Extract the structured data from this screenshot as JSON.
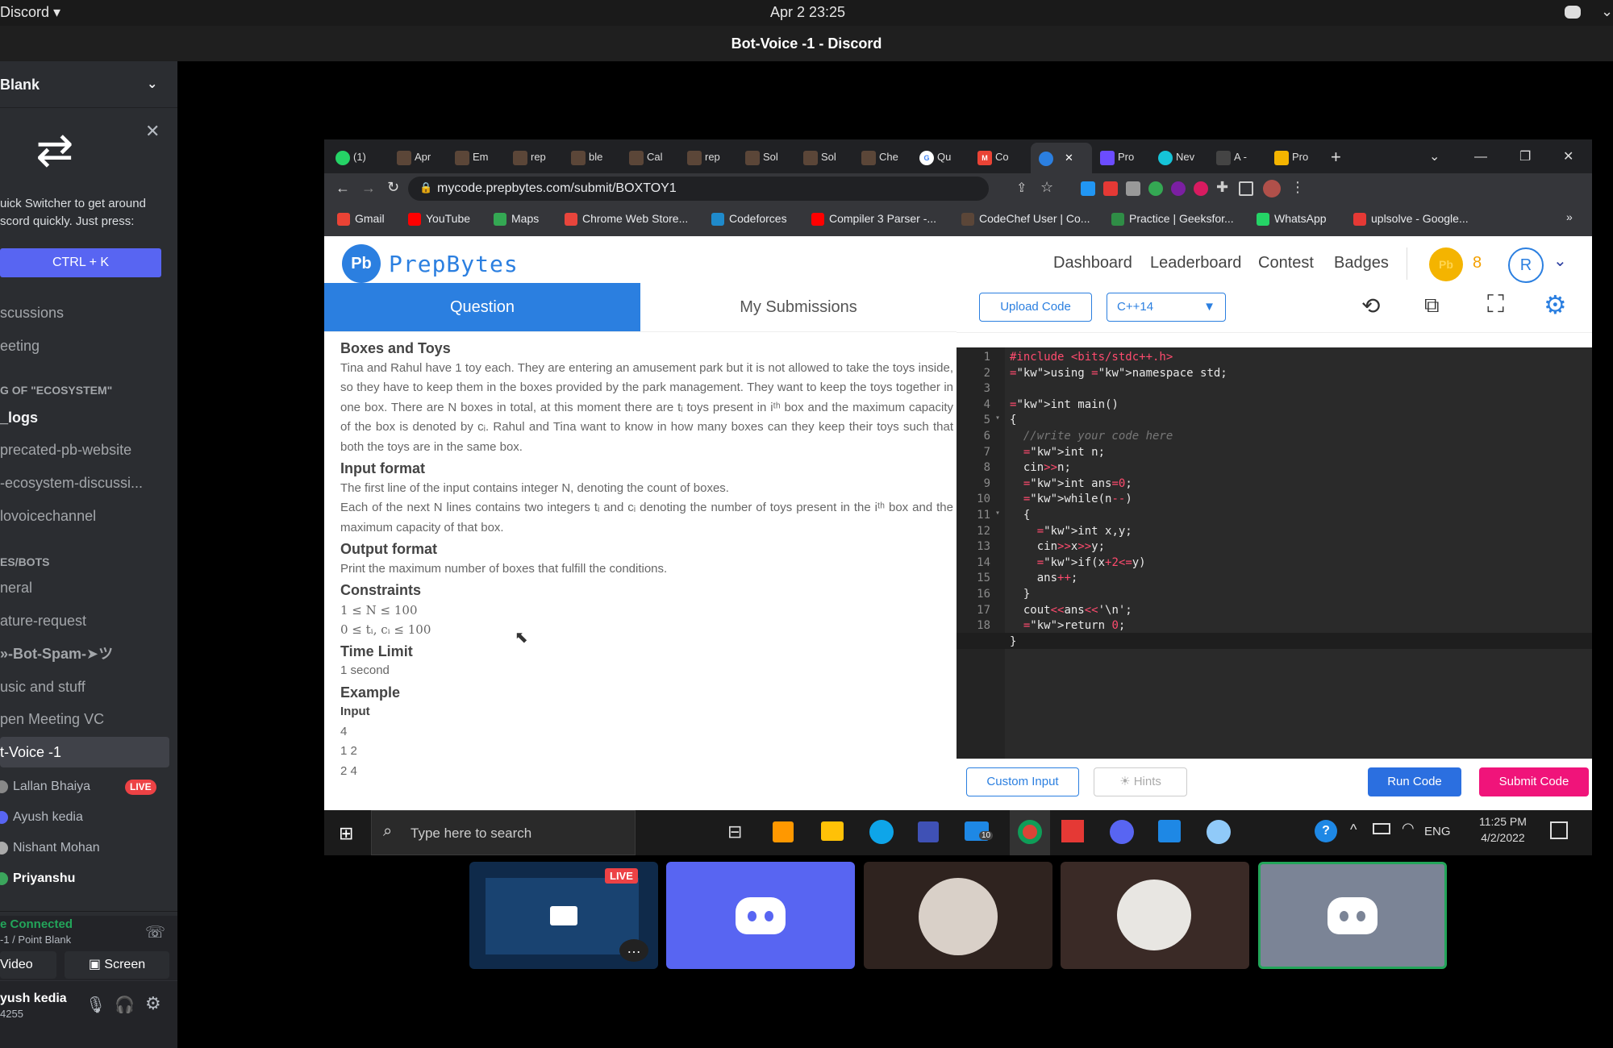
{
  "os": {
    "app_menu": "Discord",
    "clock": "Apr 2  23:25"
  },
  "window": {
    "title": "Bot-Voice -1 - Discord"
  },
  "sidebar": {
    "server": "Blank",
    "switcher_text_1": "uick Switcher to get around",
    "switcher_text_2": "scord quickly. Just press:",
    "shortcut": "CTRL + K",
    "channels_top": [
      "scussions",
      "eeting"
    ],
    "category1": "G OF \"ECOSYSTEM\"",
    "channels_eco": [
      "_logs",
      "precated-pb-website",
      "-ecosystem-discussi...",
      "lovoicechannel"
    ],
    "category2": "ES/BOTS",
    "channels_bots": [
      "neral",
      "ature-request",
      "»-Bot-Spam-➤ツ",
      "usic and stuff",
      "pen Meeting VC",
      "t-Voice -1"
    ],
    "voice_users": [
      "Lallan Bhaiya",
      "Ayush kedia",
      "Nishant Mohan",
      "Priyanshu"
    ],
    "live_badge": "LIVE",
    "connected": "e Connected",
    "connected_sub": "-1 / Point Blank",
    "video_btn": "Video",
    "screen_btn": "Screen",
    "user_name": "yush kedia",
    "user_tag": "4255"
  },
  "browser": {
    "tabs": [
      "(1)",
      "Apr",
      "Em",
      "rep",
      "ble",
      "Cal",
      "rep",
      "Sol",
      "Sol",
      "Che",
      "Qu",
      "Co",
      "",
      "Pro",
      "Nev",
      "A -",
      "Pro"
    ],
    "url": "mycode.prepbytes.com/submit/BOXTOY1",
    "bookmarks": [
      "Gmail",
      "YouTube",
      "Maps",
      "Chrome Web Store...",
      "Codeforces",
      "Compiler 3 Parser -...",
      "CodeChef User | Co...",
      "Practice | Geeksfor...",
      "WhatsApp",
      "uplsolve - Google..."
    ],
    "bookmark_colors": [
      "#ea4335",
      "#ff0000",
      "#34a853",
      "#e8453c",
      "#1f8acb",
      "#ff0000",
      "#5b4638",
      "#2f8d46",
      "#25d366",
      "#e53935"
    ]
  },
  "prepbytes": {
    "logo": "PrepBytes",
    "nav": [
      "Dashboard",
      "Leaderboard",
      "Contest",
      "Badges"
    ],
    "coins": "8",
    "avatar": "R",
    "tab_question": "Question",
    "tab_submissions": "My Submissions",
    "upload": "Upload Code",
    "lang": "C++14",
    "custom_input": "Custom Input",
    "hints": "Hints",
    "run": "Run Code",
    "submit": "Submit Code"
  },
  "problem": {
    "title": "Boxes and Toys",
    "statement": "Tina and Rahul have 1 toy each. They are entering an amusement park but it is not allowed to take the toys inside, so they have to keep them in the boxes provided by the park management. They want to keep the toys together in one box. There are N boxes in total, at this moment there are tᵢ toys present in iᵗʰ box and the maximum capacity of the box is denoted by cᵢ. Rahul and Tina want to know in how many boxes can they keep their toys such that both the toys are in the same box.",
    "input_h": "Input format",
    "input_1": "The first line of the input contains integer N, denoting the count of boxes.",
    "input_2": "Each of the next N lines contains two integers tᵢ and cᵢ denoting the number of toys present in the iᵗʰ box and the maximum capacity of that box.",
    "output_h": "Output format",
    "output_1": "Print the maximum number of boxes that fulfill the conditions.",
    "constraints_h": "Constraints",
    "c1": "1 ≤ N ≤ 100",
    "c2": "0 ≤ tᵢ, cᵢ ≤ 100",
    "time_h": "Time Limit",
    "time_v": "1 second",
    "example_h": "Example",
    "example_input": "Input",
    "ex1": "4",
    "ex2": "1 2",
    "ex3": "2 4"
  },
  "code_lines": [
    "#include <bits/stdc++.h>",
    "using namespace std;",
    "",
    "int main()",
    "{",
    "  //write your code here",
    "  int n;",
    "  cin>>n;",
    "  int ans=0;",
    "  while(n--)",
    "  {",
    "    int x,y;",
    "    cin>>x>>y;",
    "    if(x+2<=y)",
    "    ans++;",
    "  }",
    "  cout<<ans<<'\\n';",
    "  return 0;",
    "}"
  ],
  "taskbar": {
    "search": "Type here to search",
    "lang": "ENG",
    "time": "11:25 PM",
    "date": "4/2/2022",
    "mail_count": "10"
  },
  "tiles": {
    "live": "LIVE"
  }
}
